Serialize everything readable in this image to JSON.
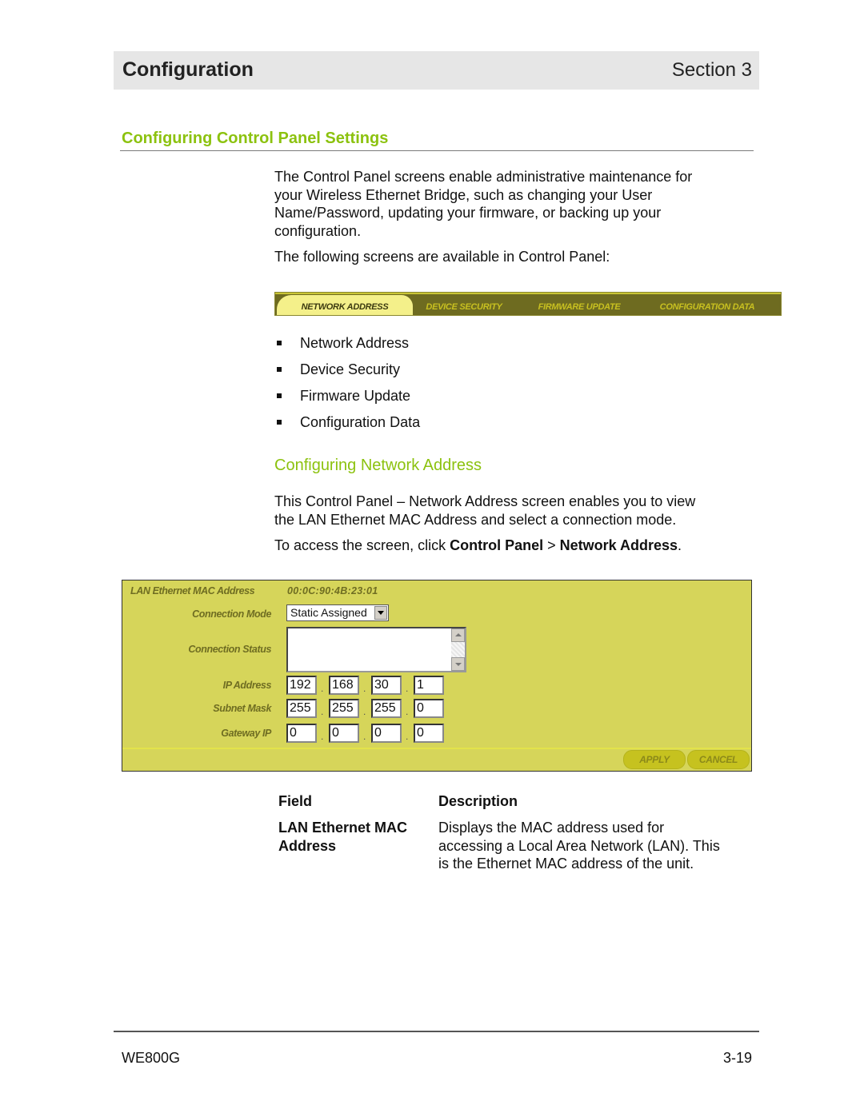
{
  "header": {
    "title": "Configuration",
    "section": "Section 3"
  },
  "heading": "Configuring Control Panel Settings",
  "intro": {
    "lines": [
      "The Control Panel screens enable administrative maintenance for",
      "your Wireless Ethernet Bridge, such as changing your User",
      "Name/Password, updating your firmware, or backing up your",
      "configuration."
    ],
    "available": "The following screens are available in Control Panel:"
  },
  "tabbar": {
    "tabs": [
      {
        "label": "NETWORK ADDRESS",
        "active": true
      },
      {
        "label": "DEVICE SECURITY",
        "active": false
      },
      {
        "label": "FIRMWARE UPDATE",
        "active": false
      },
      {
        "label": "CONFIGURATION DATA",
        "active": false
      }
    ]
  },
  "bullets": [
    "Network Address",
    "Device Security",
    "Firmware Update",
    "Configuration Data"
  ],
  "subheading": "Configuring Network Address",
  "network_intro": {
    "lines": [
      "This Control Panel – Network Address screen enables you to view",
      "the LAN Ethernet MAC Address and select a connection mode."
    ],
    "access_prefix": "To access the screen, click ",
    "access_bold1": "Control Panel",
    "access_sep": " > ",
    "access_bold2": "Network Address",
    "access_suffix": "."
  },
  "panel": {
    "mac_label": "LAN Ethernet MAC Address",
    "mac_value": "00:0C:90:4B:23:01",
    "connection_mode_label": "Connection Mode",
    "connection_mode_value": "Static Assigned",
    "connection_status_label": "Connection Status",
    "connection_status_value": "",
    "ip_label": "IP Address",
    "ip": [
      "192",
      "168",
      "30",
      "1"
    ],
    "subnet_label": "Subnet Mask",
    "subnet": [
      "255",
      "255",
      "255",
      "0"
    ],
    "gateway_label": "Gateway IP",
    "gateway": [
      "0",
      "0",
      "0",
      "0"
    ],
    "dot": ".",
    "apply_label": "APPLY",
    "cancel_label": "CANCEL",
    "colors": {
      "background": "#d6d55a",
      "label": "#6f6d22",
      "button": "#c6c21f"
    }
  },
  "table": {
    "col_field": "Field",
    "col_description": "Description",
    "rows": [
      {
        "field_lines": [
          "LAN Ethernet MAC",
          "Address"
        ],
        "description_lines": [
          "Displays the MAC address used for",
          "accessing a Local Area Network (LAN). This",
          "is the Ethernet MAC address of the unit."
        ]
      }
    ]
  },
  "footer": {
    "model": "WE800G",
    "page": "3-19"
  },
  "colors": {
    "accent_green": "#8cc20f",
    "header_bg": "#e6e6e6"
  }
}
